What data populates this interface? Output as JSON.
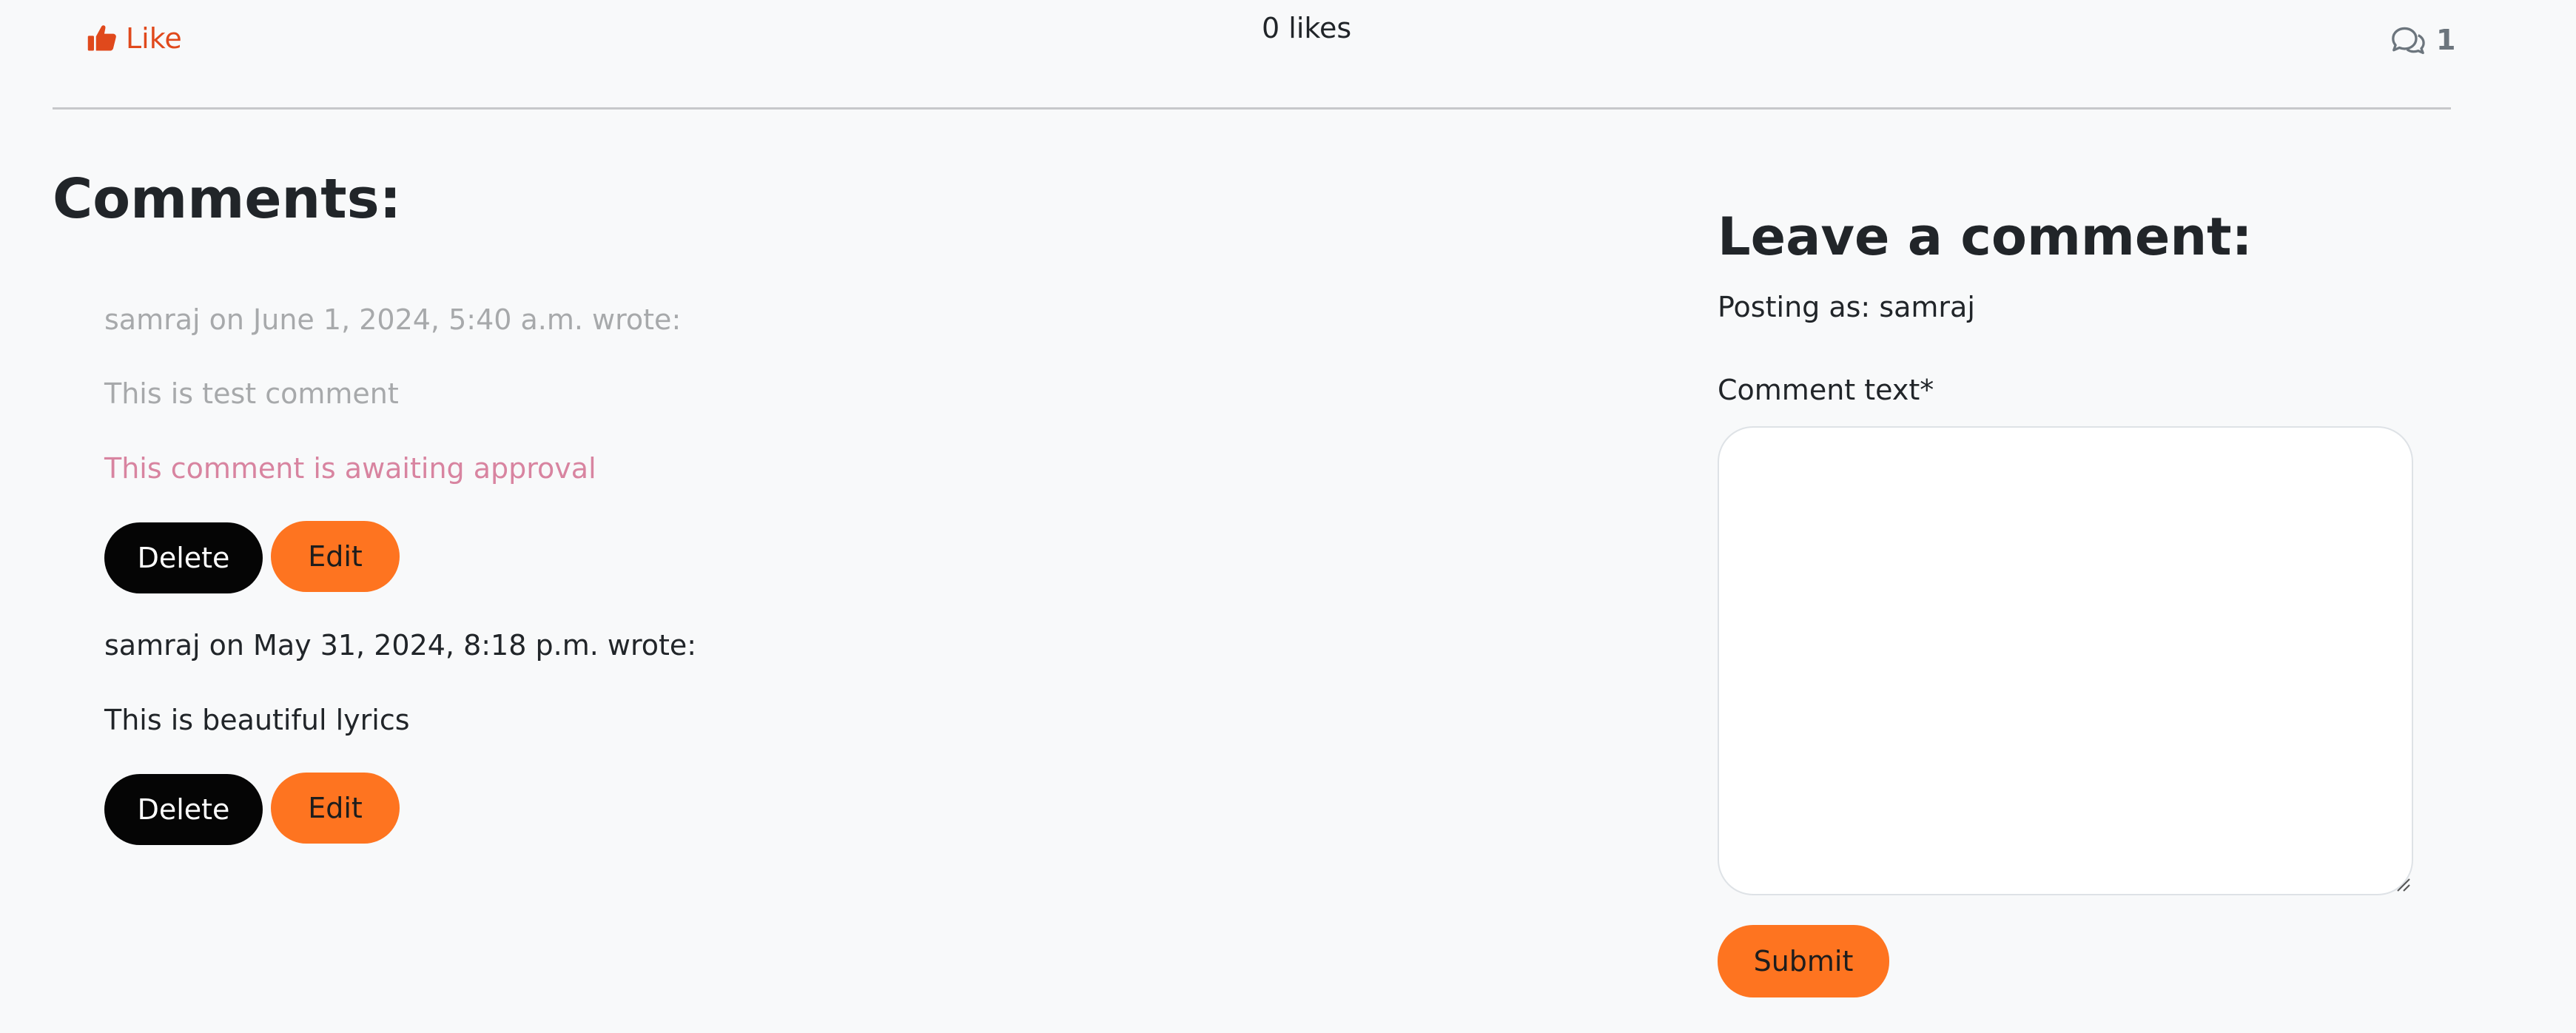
{
  "post_actions": {
    "like_label": "Like",
    "likes_text": "0 likes",
    "comment_count": "1"
  },
  "comments": {
    "heading": "Comments:",
    "items": [
      {
        "meta": "samraj on June 1, 2024, 5:40 a.m. wrote:",
        "body": "This is test comment",
        "pending": "This comment is awaiting approval",
        "delete_label": "Delete",
        "edit_label": "Edit"
      },
      {
        "meta": "samraj on May 31, 2024, 8:18 p.m. wrote:",
        "body": "This is beautiful lyrics",
        "delete_label": "Delete",
        "edit_label": "Edit"
      }
    ]
  },
  "comment_form": {
    "heading": "Leave a comment:",
    "posting_as": "Posting as: samraj",
    "field_label": "Comment text*",
    "textarea_value": "",
    "submit_label": "Submit"
  },
  "icons": {
    "like": "thumbs-up-icon",
    "comments": "chat-bubbles-icon"
  },
  "colors": {
    "accent": "#fe7420",
    "like": "#e0491c",
    "pending": "#d884a0",
    "delete_button": "#050505"
  }
}
